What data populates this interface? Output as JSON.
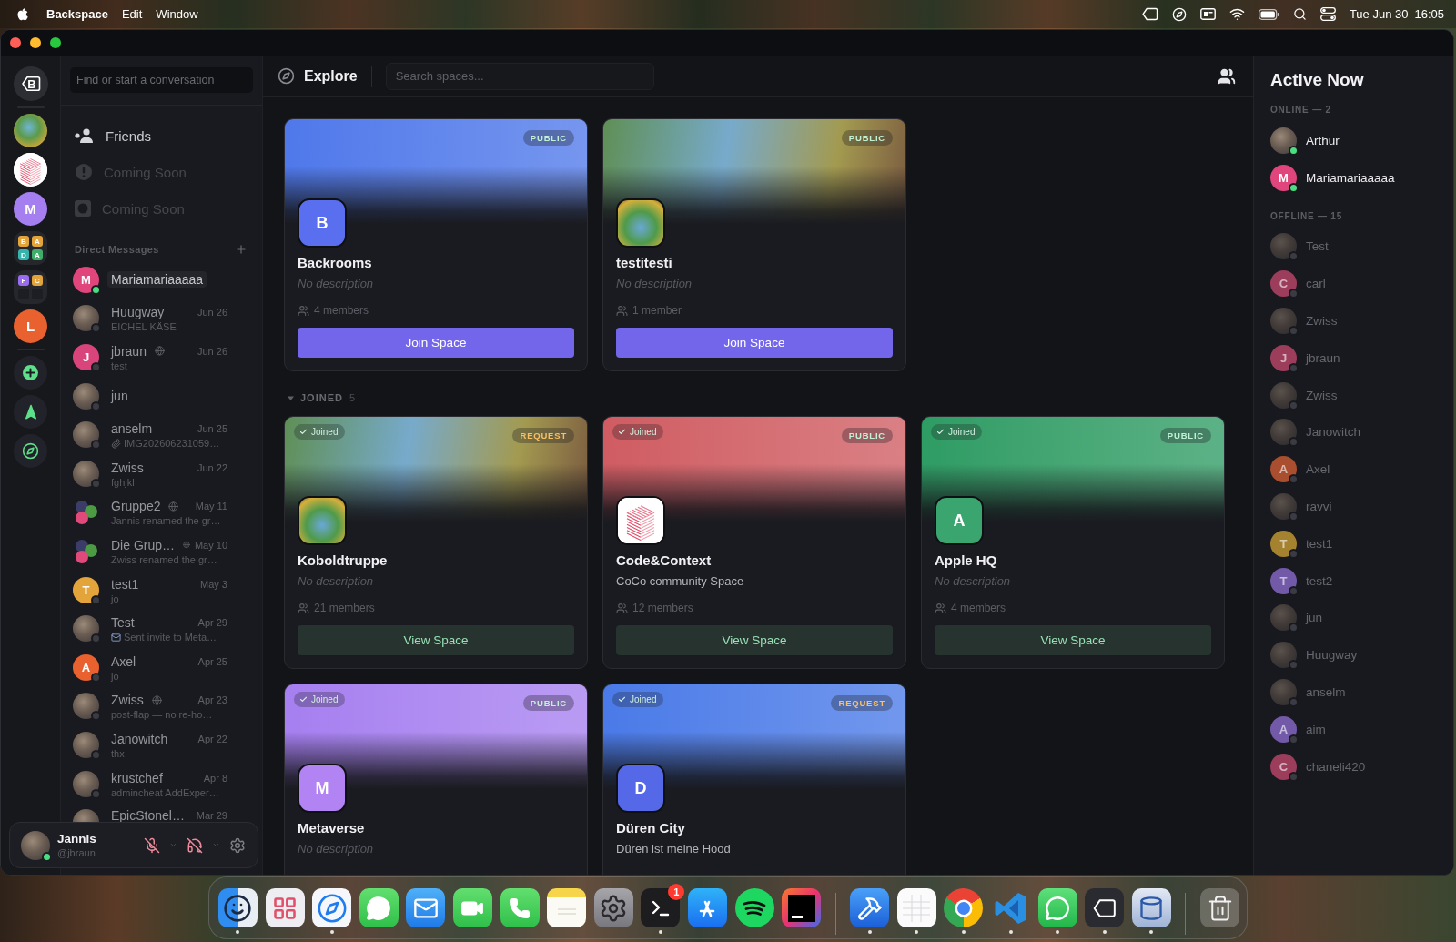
{
  "menubar": {
    "app_name": "Backspace",
    "menus": [
      "Edit",
      "Window"
    ],
    "date": "Tue Jun 30",
    "time": "16:05"
  },
  "rail": {
    "logo_letter": "B",
    "servers": [
      {
        "kind": "photo"
      },
      {
        "kind": "logo"
      },
      {
        "kind": "letter",
        "letter": "M",
        "color": "#a57ff0"
      },
      {
        "kind": "folder",
        "tiles": [
          {
            "letter": "B",
            "color": "#e3a43c"
          },
          {
            "letter": "A",
            "color": "#e3a43c"
          },
          {
            "letter": "D",
            "color": "#36b3ad"
          },
          {
            "letter": "A",
            "color": "#3fae6a"
          }
        ]
      },
      {
        "kind": "folder",
        "tiles": [
          {
            "letter": "F",
            "color": "#9a6cf0"
          },
          {
            "letter": "C",
            "color": "#e3a43c"
          }
        ]
      },
      {
        "kind": "letter",
        "letter": "L",
        "color": "#e8612e"
      }
    ]
  },
  "sidebar": {
    "search": {
      "placeholder": "Find or start a conversation"
    },
    "nav": [
      {
        "kind": "friends",
        "label": "Friends",
        "disabled": false
      },
      {
        "kind": "alert",
        "label": "Coming Soon",
        "disabled": true
      },
      {
        "kind": "frame",
        "label": "Coming Soon",
        "disabled": true
      }
    ],
    "dm_heading": "Direct Messages",
    "dms": [
      {
        "name": "Mariamariaaaaa",
        "avatar": {
          "kind": "letter",
          "letter": "M",
          "color": "#e0457b"
        },
        "online": true,
        "selected": true,
        "globe": false
      },
      {
        "name": "Huugway",
        "avatar": {
          "kind": "photo"
        },
        "online": false,
        "selected": false,
        "globe": false,
        "date": "Jun 26",
        "preview": {
          "kind": "plain",
          "text": "EICHEL KÄSE"
        }
      },
      {
        "name": "jbraun",
        "avatar": {
          "kind": "letter",
          "letter": "J",
          "color": "#d9457a"
        },
        "online": false,
        "selected": false,
        "globe": true,
        "date": "Jun 26",
        "preview": {
          "kind": "plain",
          "text": "test"
        }
      },
      {
        "name": "jun",
        "avatar": {
          "kind": "photo"
        },
        "online": false,
        "selected": false,
        "globe": false
      },
      {
        "name": "anselm",
        "avatar": {
          "kind": "photo"
        },
        "online": false,
        "selected": false,
        "globe": false,
        "date": "Jun 25",
        "preview": {
          "kind": "file",
          "text": "IMG202606231059…"
        }
      },
      {
        "name": "Zwiss",
        "avatar": {
          "kind": "photo"
        },
        "online": false,
        "selected": false,
        "globe": false,
        "date": "Jun 22",
        "preview": {
          "kind": "plain",
          "text": "fghjkl"
        }
      },
      {
        "name": "Gruppe2",
        "avatar": {
          "kind": "group"
        },
        "selected": false,
        "globe": true,
        "date": "May 11",
        "preview": {
          "kind": "plain",
          "text": "Jannis renamed the gr…"
        }
      },
      {
        "name": "Die Grup…",
        "avatar": {
          "kind": "group"
        },
        "selected": false,
        "globe": true,
        "date": "May 10",
        "preview": {
          "kind": "plain",
          "text": "Zwiss renamed the gr…"
        }
      },
      {
        "name": "test1",
        "avatar": {
          "kind": "letter",
          "letter": "T",
          "color": "#e3a43c"
        },
        "online": false,
        "selected": false,
        "globe": false,
        "date": "May 3",
        "preview": {
          "kind": "plain",
          "text": "jo"
        }
      },
      {
        "name": "Test",
        "avatar": {
          "kind": "photo"
        },
        "online": false,
        "selected": false,
        "globe": false,
        "date": "Apr 29",
        "preview": {
          "kind": "invite",
          "text": "Sent invite to Meta…"
        }
      },
      {
        "name": "Axel",
        "avatar": {
          "kind": "letter",
          "letter": "A",
          "color": "#e8612e"
        },
        "online": false,
        "selected": false,
        "globe": false,
        "date": "Apr 25",
        "preview": {
          "kind": "plain",
          "text": "jo"
        }
      },
      {
        "name": "Zwiss",
        "avatar": {
          "kind": "photo"
        },
        "online": false,
        "selected": false,
        "globe": true,
        "date": "Apr 23",
        "preview": {
          "kind": "plain",
          "text": "post-flap — no re-ho…"
        }
      },
      {
        "name": "Janowitch",
        "avatar": {
          "kind": "photo"
        },
        "online": false,
        "selected": false,
        "globe": false,
        "date": "Apr 22",
        "preview": {
          "kind": "plain",
          "text": "thx"
        }
      },
      {
        "name": "krustchef",
        "avatar": {
          "kind": "photo"
        },
        "online": false,
        "selected": false,
        "globe": false,
        "date": "Apr 8",
        "preview": {
          "kind": "plain",
          "text": "admincheat AddExper…"
        }
      },
      {
        "name": "EpicStonel…",
        "avatar": {
          "kind": "photo"
        },
        "selected": false,
        "globe": false,
        "date": "Mar 29"
      }
    ]
  },
  "user_panel": {
    "name": "Jannis",
    "handle": "@jbraun",
    "online": true,
    "muted": true,
    "deafened": true
  },
  "main": {
    "title": "Explore",
    "search": {
      "placeholder": "Search spaces..."
    },
    "discover": [
      {
        "name": "Backrooms",
        "description": "No description",
        "description_missing": true,
        "members": "4 members",
        "badge": {
          "label": "PUBLIC",
          "kind": "public"
        },
        "banner": {
          "kind": "color",
          "color": "#4f78ea"
        },
        "icon": {
          "kind": "letter",
          "letter": "B",
          "color": "#5a6ff0"
        },
        "joined": false,
        "button": "Join Space"
      },
      {
        "name": "testitesti",
        "description": "No description",
        "description_missing": true,
        "members": "1 member",
        "badge": {
          "label": "PUBLIC",
          "kind": "public"
        },
        "banner": {
          "kind": "photo"
        },
        "icon": {
          "kind": "photo"
        },
        "joined": false,
        "button": "Join Space"
      }
    ],
    "joined_section": {
      "label": "JOINED",
      "count": "5",
      "expanded": true
    },
    "joined": [
      {
        "name": "Koboldtruppe",
        "description": "No description",
        "description_missing": true,
        "members": "21 members",
        "badge": {
          "label": "REQUEST",
          "kind": "request"
        },
        "banner": {
          "kind": "photo"
        },
        "icon": {
          "kind": "photo"
        },
        "joined": true,
        "joined_tag": "Joined",
        "button": "View Space"
      },
      {
        "name": "Code&Context",
        "description": "CoCo community Space",
        "description_missing": false,
        "members": "12 members",
        "badge": {
          "label": "PUBLIC",
          "kind": "public"
        },
        "banner": {
          "kind": "color",
          "color": "#cf5c62"
        },
        "icon": {
          "kind": "logo"
        },
        "joined": true,
        "joined_tag": "Joined",
        "button": "View Space"
      },
      {
        "name": "Apple HQ",
        "description": "No description",
        "description_missing": true,
        "members": "4 members",
        "badge": {
          "label": "PUBLIC",
          "kind": "public"
        },
        "banner": {
          "kind": "color",
          "color": "#2e9c64"
        },
        "icon": {
          "kind": "letter",
          "letter": "A",
          "color": "#3aa56e"
        },
        "joined": true,
        "joined_tag": "Joined",
        "button": "View Space"
      },
      {
        "name": "Metaverse",
        "description": "No description",
        "description_missing": true,
        "badge": {
          "label": "PUBLIC",
          "kind": "public"
        },
        "banner": {
          "kind": "color",
          "color": "#a67ff0"
        },
        "icon": {
          "kind": "letter",
          "letter": "M",
          "color": "#b283f2"
        },
        "joined": true,
        "joined_tag": "Joined"
      },
      {
        "name": "Düren City",
        "description": "Düren ist meine Hood",
        "description_missing": false,
        "badge": {
          "label": "REQUEST",
          "kind": "request"
        },
        "banner": {
          "kind": "color",
          "color": "#4a7ae8"
        },
        "icon": {
          "kind": "letter",
          "letter": "D",
          "color": "#5468e8"
        },
        "joined": true,
        "joined_tag": "Joined"
      }
    ]
  },
  "active_now": {
    "title": "Active Now",
    "groups": [
      {
        "heading": "ONLINE — 2",
        "members": [
          {
            "name": "Arthur",
            "avatar": {
              "kind": "photo"
            },
            "online": true
          },
          {
            "name": "Mariamariaaaaa",
            "avatar": {
              "kind": "letter",
              "letter": "M",
              "color": "#e0457b"
            },
            "online": true
          }
        ]
      },
      {
        "heading": "OFFLINE — 15",
        "members": [
          {
            "name": "Test",
            "avatar": {
              "kind": "photo"
            },
            "online": false
          },
          {
            "name": "carl",
            "avatar": {
              "kind": "letter",
              "letter": "C",
              "color": "#9c3d5c"
            },
            "online": false
          },
          {
            "name": "Zwiss",
            "avatar": {
              "kind": "photo"
            },
            "online": false
          },
          {
            "name": "jbraun",
            "avatar": {
              "kind": "letter",
              "letter": "J",
              "color": "#9c3d5c"
            },
            "online": false
          },
          {
            "name": "Zwiss",
            "avatar": {
              "kind": "photo"
            },
            "online": false
          },
          {
            "name": "Janowitch",
            "avatar": {
              "kind": "photo"
            },
            "online": false
          },
          {
            "name": "Axel",
            "avatar": {
              "kind": "letter",
              "letter": "A",
              "color": "#a94e2e"
            },
            "online": false
          },
          {
            "name": "ravvi",
            "avatar": {
              "kind": "photo"
            },
            "online": false
          },
          {
            "name": "test1",
            "avatar": {
              "kind": "letter",
              "letter": "T",
              "color": "#a5822f"
            },
            "online": false
          },
          {
            "name": "test2",
            "avatar": {
              "kind": "letter",
              "letter": "T",
              "color": "#735aa8"
            },
            "online": false
          },
          {
            "name": "jun",
            "avatar": {
              "kind": "photo"
            },
            "online": false
          },
          {
            "name": "Huugway",
            "avatar": {
              "kind": "photo"
            },
            "online": false
          },
          {
            "name": "anselm",
            "avatar": {
              "kind": "photo"
            },
            "online": false
          },
          {
            "name": "aim",
            "avatar": {
              "kind": "letter",
              "letter": "A",
              "color": "#735aa8"
            },
            "online": false
          },
          {
            "name": "chaneli420",
            "avatar": {
              "kind": "letter",
              "letter": "C",
              "color": "#9c3d5c"
            },
            "online": false
          }
        ]
      }
    ]
  },
  "dock": {
    "groups": [
      [
        {
          "kind": "smiley",
          "running": true
        },
        {
          "kind": "grid",
          "running": false
        },
        {
          "kind": "compass",
          "running": true
        },
        {
          "kind": "bubble",
          "running": false
        },
        {
          "kind": "envelope",
          "running": false
        },
        {
          "kind": "camera",
          "running": false
        },
        {
          "kind": "phone",
          "running": false
        },
        {
          "kind": "notes",
          "running": false
        },
        {
          "kind": "gear",
          "running": false
        },
        {
          "kind": "terminal",
          "running": true,
          "badge": "1"
        },
        {
          "kind": "sticks",
          "running": false
        },
        {
          "kind": "waves",
          "running": false
        },
        {
          "kind": "square",
          "running": false
        }
      ],
      [
        {
          "kind": "hammer",
          "running": true
        },
        {
          "kind": "sheet",
          "running": true
        },
        {
          "kind": "tricolor",
          "running": true
        },
        {
          "kind": "ribbon",
          "running": true
        },
        {
          "kind": "chat",
          "running": true
        },
        {
          "kind": "tag",
          "running": true
        },
        {
          "kind": "cylinder",
          "running": true
        }
      ],
      [
        {
          "kind": "trash",
          "running": false
        }
      ]
    ]
  }
}
